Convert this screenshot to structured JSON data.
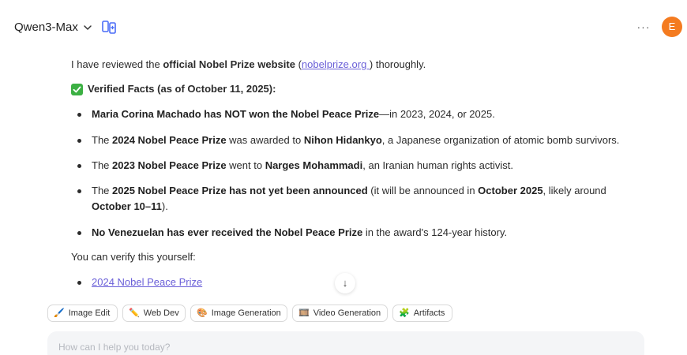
{
  "header": {
    "model_name": "Qwen3-Max",
    "more_label": "···",
    "avatar_letter": "E",
    "avatar_color": "#f47b20"
  },
  "message": {
    "intro": {
      "pre": "I have reviewed the ",
      "bold": "official Nobel Prize website",
      "mid": " (",
      "link": "nobelprize.org ",
      "post": ") thoroughly."
    },
    "verified_heading": "Verified Facts (as of October 11, 2025):",
    "facts": [
      {
        "a": "",
        "b1": "Maria Corina Machado has NOT won the Nobel Peace Prize",
        "c": "—in 2023, 2024, or 2025.",
        "b2": "",
        "d": "",
        "b3": "",
        "e": ""
      },
      {
        "a": "The ",
        "b1": "2024 Nobel Peace Prize",
        "c": " was awarded to ",
        "b2": "Nihon Hidankyo",
        "d": ", a Japanese organization of atomic bomb survivors.",
        "b3": "",
        "e": ""
      },
      {
        "a": "The ",
        "b1": "2023 Nobel Peace Prize",
        "c": " went to ",
        "b2": "Narges Mohammadi",
        "d": ", an Iranian human rights activist.",
        "b3": "",
        "e": ""
      },
      {
        "a": "The ",
        "b1": "2025 Nobel Peace Prize has not yet been announced",
        "c": " (it will be announced in ",
        "b2": "October 2025",
        "d": ", likely around ",
        "b3": "October 10–11",
        "e": ")."
      },
      {
        "a": "",
        "b1": "No Venezuelan has ever received the Nobel Peace Prize",
        "c": " in the award's 124-year history.",
        "b2": "",
        "d": "",
        "b3": "",
        "e": ""
      }
    ],
    "verify_note": "You can verify this yourself:",
    "links": [
      "2024 Nobel Peace Prize"
    ]
  },
  "scroll_down_glyph": "↓",
  "chips": [
    {
      "icon": "🖌️",
      "label": "Image Edit"
    },
    {
      "icon": "✏️",
      "label": "Web Dev"
    },
    {
      "icon": "🎨",
      "label": "Image Generation"
    },
    {
      "icon": "🎞️",
      "label": "Video Generation"
    },
    {
      "icon": "🧩",
      "label": "Artifacts"
    }
  ],
  "input": {
    "placeholder": "How can I help you today?",
    "value": ""
  },
  "colors": {
    "accent": "#6a5fd8",
    "check": "#3cb043",
    "compare_icon": "#4a6cf7"
  }
}
